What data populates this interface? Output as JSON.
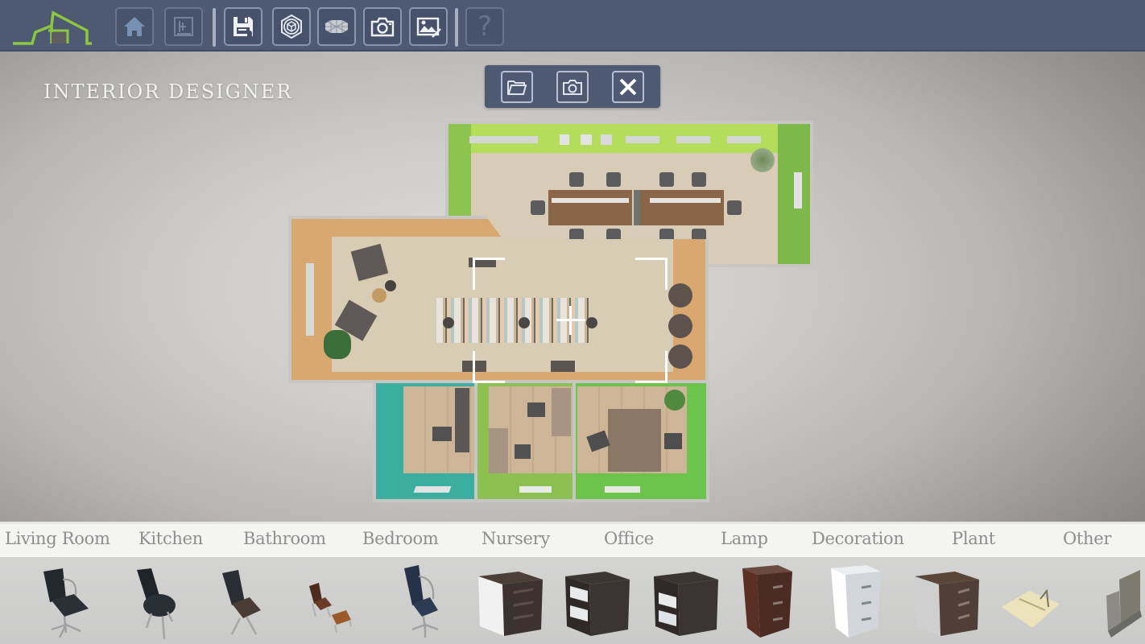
{
  "toolbar": {
    "logo": "house-logo-icon",
    "buttons": [
      {
        "name": "home",
        "icon": "home-icon",
        "enabled": false
      },
      {
        "name": "floorplan",
        "icon": "blueprint-icon",
        "enabled": false
      },
      {
        "name": "save",
        "icon": "save-icon",
        "enabled": true
      },
      {
        "name": "3d-view",
        "icon": "cube-view-icon",
        "enabled": true
      },
      {
        "name": "wireframe",
        "icon": "wireframe-icon",
        "enabled": true
      },
      {
        "name": "screenshot",
        "icon": "camera-icon",
        "enabled": true
      },
      {
        "name": "gallery",
        "icon": "image-edit-icon",
        "enabled": true
      },
      {
        "name": "help",
        "icon": "help-icon",
        "label": "?",
        "enabled": false
      }
    ]
  },
  "app_title": "INTERIOR DESIGNER",
  "popup": {
    "buttons": [
      {
        "name": "open",
        "icon": "folder-open-icon"
      },
      {
        "name": "capture",
        "icon": "camera-icon"
      },
      {
        "name": "close",
        "icon": "close-icon"
      }
    ]
  },
  "colors": {
    "toolbar_bg": "#4e5a72",
    "logo_green": "#8dc63f",
    "wall_lime": "#a8d44a",
    "wall_green": "#7dbb4a",
    "wall_teal": "#3aaea0",
    "wall_orange": "#d9a25e"
  },
  "categories": [
    {
      "label": "Living Room"
    },
    {
      "label": "Kitchen"
    },
    {
      "label": "Bathroom"
    },
    {
      "label": "Bedroom"
    },
    {
      "label": "Nursery"
    },
    {
      "label": "Office"
    },
    {
      "label": "Lamp"
    },
    {
      "label": "Decoration"
    },
    {
      "label": "Plant"
    },
    {
      "label": "Other"
    }
  ],
  "items": [
    {
      "name": "office-chair-black-armrest",
      "icon": "office-chair-icon"
    },
    {
      "name": "shell-chair-black",
      "icon": "chair-icon"
    },
    {
      "name": "sled-chair-dark",
      "icon": "chair-icon"
    },
    {
      "name": "lounge-chair-with-ottoman",
      "icon": "lounge-chair-icon"
    },
    {
      "name": "office-chair-navy",
      "icon": "office-chair-icon"
    },
    {
      "name": "drawer-cabinet-white-dark-top",
      "icon": "cabinet-icon"
    },
    {
      "name": "open-shelf-cabinet-1",
      "icon": "shelf-cabinet-icon"
    },
    {
      "name": "open-shelf-cabinet-2",
      "icon": "shelf-cabinet-icon"
    },
    {
      "name": "tall-filing-cabinet-brown",
      "icon": "filing-cabinet-icon"
    },
    {
      "name": "tall-filing-cabinet-white",
      "icon": "filing-cabinet-icon"
    },
    {
      "name": "drawer-cabinet-grey-brown-top",
      "icon": "cabinet-icon"
    },
    {
      "name": "desk-pad-document",
      "icon": "document-icon"
    },
    {
      "name": "partition-panel",
      "icon": "panel-icon"
    }
  ]
}
